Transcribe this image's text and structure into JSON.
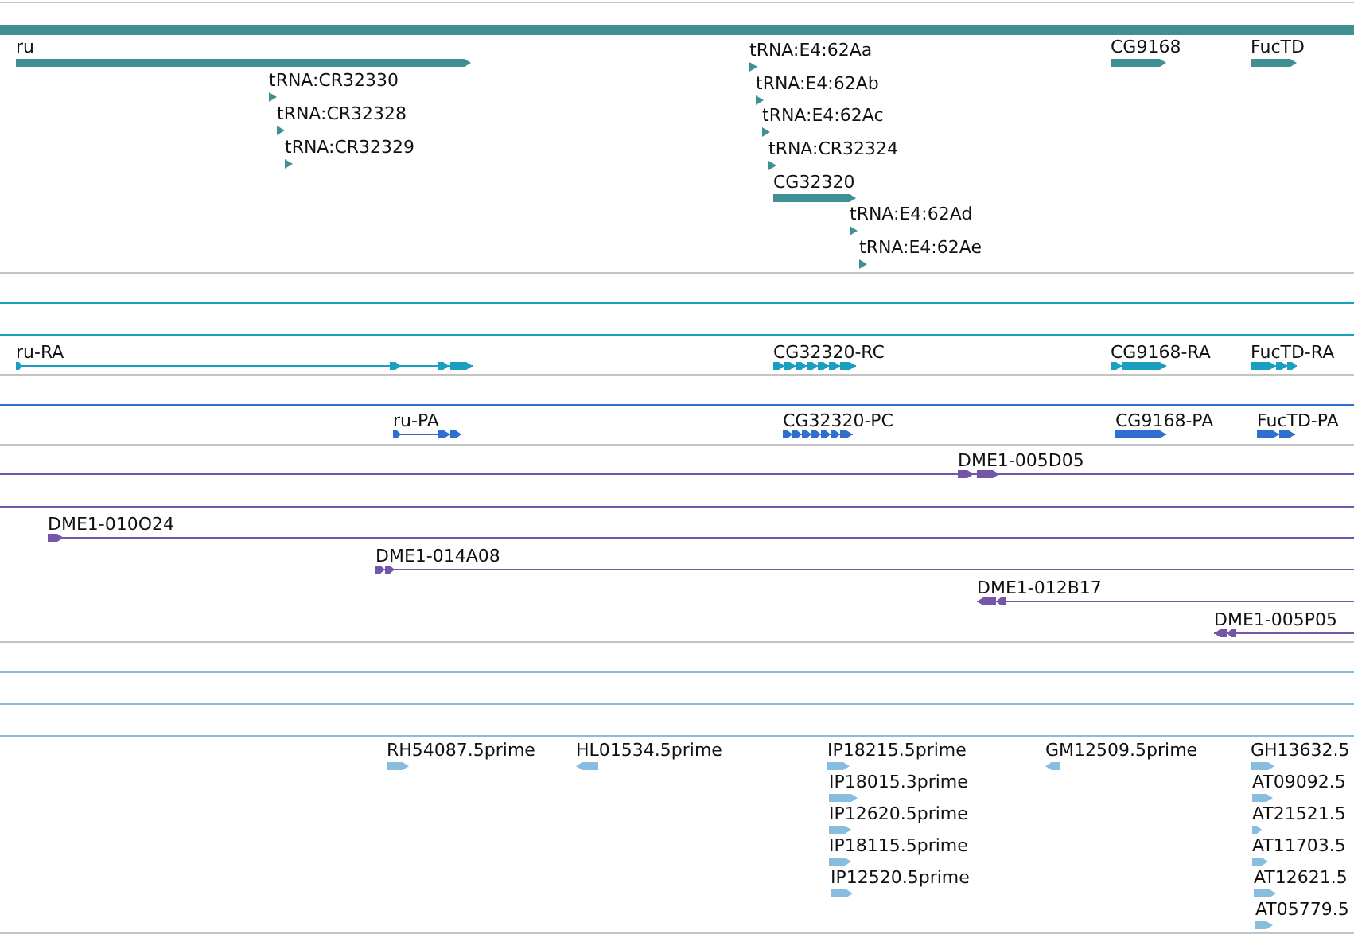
{
  "tracks": [
    {
      "color": "#3f8f93",
      "features": [
        {
          "kind": "span"
        },
        {
          "kind": "gene",
          "label": "ru",
          "reverse": false
        },
        {
          "kind": "trna",
          "label": "tRNA:E4:62Aa",
          "reverse": false
        },
        {
          "kind": "gene",
          "label": "CG9168",
          "reverse": false
        },
        {
          "kind": "gene",
          "label": "FucTD",
          "reverse": false
        },
        {
          "kind": "trna",
          "label": "tRNA:CR32330",
          "reverse": false
        },
        {
          "kind": "trna",
          "label": "tRNA:E4:62Ab",
          "reverse": false
        },
        {
          "kind": "trna",
          "label": "tRNA:CR32328",
          "reverse": false
        },
        {
          "kind": "trna",
          "label": "tRNA:E4:62Ac",
          "reverse": false
        },
        {
          "kind": "trna",
          "label": "tRNA:CR32329",
          "reverse": false
        },
        {
          "kind": "trna",
          "label": "tRNA:CR32324",
          "reverse": false
        },
        {
          "kind": "gene",
          "label": "CG32320",
          "reverse": false
        },
        {
          "kind": "trna",
          "label": "tRNA:E4:62Ad",
          "reverse": false
        },
        {
          "kind": "trna",
          "label": "tRNA:E4:62Ae",
          "reverse": false
        }
      ]
    },
    {
      "color": "#1a9fc0",
      "features": [
        {
          "kind": "span"
        },
        {
          "kind": "span"
        },
        {
          "kind": "transcript",
          "label": "ru-RA",
          "reverse": false
        },
        {
          "kind": "transcript",
          "label": "CG32320-RC",
          "reverse": false
        },
        {
          "kind": "transcript",
          "label": "CG9168-RA",
          "reverse": false
        },
        {
          "kind": "transcript",
          "label": "FucTD-RA",
          "reverse": false
        }
      ]
    },
    {
      "color": "#2f6fcf",
      "features": [
        {
          "kind": "span"
        },
        {
          "kind": "transcript",
          "label": "ru-PA",
          "reverse": false
        },
        {
          "kind": "transcript",
          "label": "CG32320-PC",
          "reverse": false
        },
        {
          "kind": "transcript",
          "label": "CG9168-PA",
          "reverse": false
        },
        {
          "kind": "transcript",
          "label": "FucTD-PA",
          "reverse": false
        }
      ]
    },
    {
      "color": "#7456a8",
      "features": [
        {
          "kind": "clone",
          "label": "DME1-005D05",
          "reverse": false
        },
        {
          "kind": "span"
        },
        {
          "kind": "clone",
          "label": "DME1-010O24",
          "reverse": false
        },
        {
          "kind": "clone",
          "label": "DME1-014A08",
          "reverse": false
        },
        {
          "kind": "clone",
          "label": "DME1-012B17",
          "reverse": true
        },
        {
          "kind": "clone",
          "label": "DME1-005P05",
          "reverse": true
        }
      ]
    },
    {
      "color": "#88bde0",
      "features": [
        {
          "kind": "span"
        },
        {
          "kind": "span"
        },
        {
          "kind": "span"
        },
        {
          "kind": "est",
          "label": "RH54087.5prime",
          "reverse": false
        },
        {
          "kind": "est",
          "label": "HL01534.5prime",
          "reverse": true
        },
        {
          "kind": "est",
          "label": "IP18215.5prime",
          "reverse": false
        },
        {
          "kind": "est",
          "label": "GM12509.5prime",
          "reverse": true
        },
        {
          "kind": "est",
          "label": "GH13632.5",
          "reverse": false
        },
        {
          "kind": "est",
          "label": "IP18015.3prime",
          "reverse": false
        },
        {
          "kind": "est",
          "label": "AT09092.5",
          "reverse": false
        },
        {
          "kind": "est",
          "label": "IP12620.5prime",
          "reverse": false
        },
        {
          "kind": "est",
          "label": "AT21521.5",
          "reverse": false
        },
        {
          "kind": "est",
          "label": "IP18115.5prime",
          "reverse": false
        },
        {
          "kind": "est",
          "label": "AT11703.5",
          "reverse": false
        },
        {
          "kind": "est",
          "label": "IP12520.5prime",
          "reverse": false
        },
        {
          "kind": "est",
          "label": "AT12621.5",
          "reverse": false
        },
        {
          "kind": "est",
          "label": "AT05779.5",
          "reverse": false
        }
      ]
    }
  ]
}
